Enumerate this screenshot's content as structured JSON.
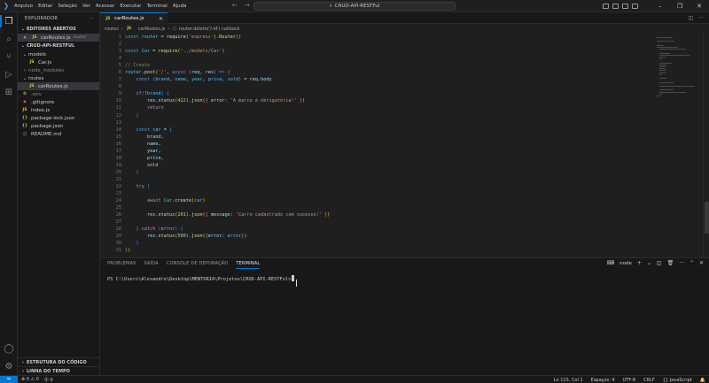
{
  "menu": [
    "Arquivo",
    "Editar",
    "Seleção",
    "Ver",
    "Acessar",
    "Executar",
    "Terminal",
    "Ajuda"
  ],
  "search": {
    "text": "CRUD-API-RESTFul"
  },
  "sidebar": {
    "title": "EXPLORADOR",
    "open_editors_header": "EDITORES ABERTOS",
    "open_editor": {
      "name": "carRoutes.js",
      "desc": "routes"
    },
    "project_header": "CRUD-API-RESTFUL",
    "tree": [
      {
        "label": "models",
        "type": "folder"
      },
      {
        "label": "Car.js",
        "type": "js"
      },
      {
        "label": "node_modules",
        "type": "folder"
      },
      {
        "label": "routes",
        "type": "folder"
      },
      {
        "label": "carRoutes.js",
        "type": "js"
      },
      {
        "label": ".env",
        "type": "env"
      },
      {
        "label": ".gitignore",
        "type": "git"
      },
      {
        "label": "index.js",
        "type": "js"
      },
      {
        "label": "package-lock.json",
        "type": "json"
      },
      {
        "label": "package.json",
        "type": "json"
      },
      {
        "label": "README.md",
        "type": "md"
      }
    ],
    "outline_header": "ESTRUTURA DO CÓDIGO",
    "timeline_header": "LINHA DO TEMPO"
  },
  "editor": {
    "tab_label": "carRoutes.js",
    "breadcrumbs": [
      "routes",
      "carRoutes.js",
      "router.delete('/:id') callback"
    ],
    "line_numbers": [
      "1",
      "2",
      "3",
      "4",
      "5",
      "6",
      "7",
      "8",
      "9",
      "10",
      "11",
      "12",
      "13",
      "14",
      "15",
      "16",
      "17",
      "18",
      "19",
      "20",
      "21",
      "22",
      "23",
      "24",
      "25",
      "26",
      "27",
      "28",
      "29",
      "30",
      "31"
    ]
  },
  "panel": {
    "tabs": [
      "PROBLEMAS",
      "SAÍDA",
      "CONSOLE DE DEPURAÇÃO",
      "TERMINAL"
    ],
    "terminal_name": "node",
    "terminal_prompt": "PS C:\\Users\\Alexandre\\Desktop\\MENTORIA\\Projetos\\CRUD-API-RESTFul>"
  },
  "status": {
    "remote_label": "",
    "errors": "0",
    "warnings": "0",
    "ports": "0",
    "position": "Ln 115, Col 1",
    "spaces": "Espaços: 4",
    "encoding": "UTF-8",
    "eol": "CRLF",
    "language": "{} JavaScript"
  }
}
